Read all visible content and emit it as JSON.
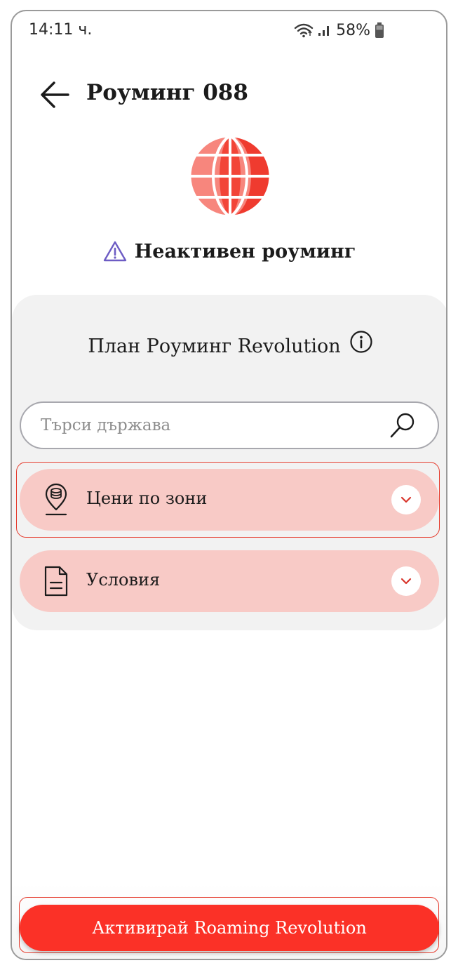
{
  "status_bar": {
    "time": "14:11 ч.",
    "battery_percent": "58%",
    "icons": [
      "wifi-icon",
      "signal-icon",
      "battery-icon"
    ]
  },
  "header": {
    "back_icon": "arrow-left-icon",
    "title": "Роуминг 088"
  },
  "roaming_status": {
    "icon": "warning-triangle-icon",
    "text": "Неактивен роуминг"
  },
  "plan": {
    "title": "План Роуминг Revolution",
    "info_icon": "info-icon"
  },
  "search": {
    "placeholder": "Търси държава",
    "value": "",
    "icon": "search-icon"
  },
  "accordions": [
    {
      "label": "Цени по зони",
      "icon": "location-coins-icon",
      "expanded": false
    },
    {
      "label": "Условия",
      "icon": "document-icon",
      "expanded": false
    }
  ],
  "cta": {
    "label": "Активирай Roaming Revolution"
  },
  "colors": {
    "accent": "#fb3127",
    "accordion_bg": "#f8cac6",
    "card_bg": "#f2f2f2",
    "warning_icon": "#6d5cc4",
    "globe_light": "#f7867d",
    "globe_dark": "#ef3b2f"
  }
}
